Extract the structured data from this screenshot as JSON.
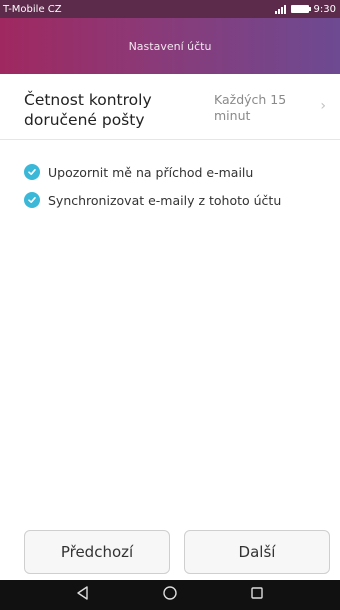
{
  "status_bar": {
    "carrier": "T-Mobile CZ",
    "time": "9:30"
  },
  "header": {
    "title": "Nastavení účtu"
  },
  "frequency": {
    "label_line1": "Četnost kontroly",
    "label_line2": "doručené pošty",
    "value_line1": "Každých 15",
    "value_line2": "minut",
    "chevron_icon": "chevron-right-icon"
  },
  "options": [
    {
      "label": "Upozornit mě na příchod e-mailu",
      "checked": true
    },
    {
      "label": "Synchronizovat e-maily z tohoto účtu",
      "checked": true
    }
  ],
  "buttons": {
    "previous": "Předchozí",
    "next": "Další"
  },
  "nav": {
    "back_icon": "back-triangle-icon",
    "home_icon": "home-circle-icon",
    "recents_icon": "recents-square-icon"
  },
  "colors": {
    "accent": "#3bb8d8",
    "header_start": "#a02860",
    "header_end": "#6d4a92"
  }
}
